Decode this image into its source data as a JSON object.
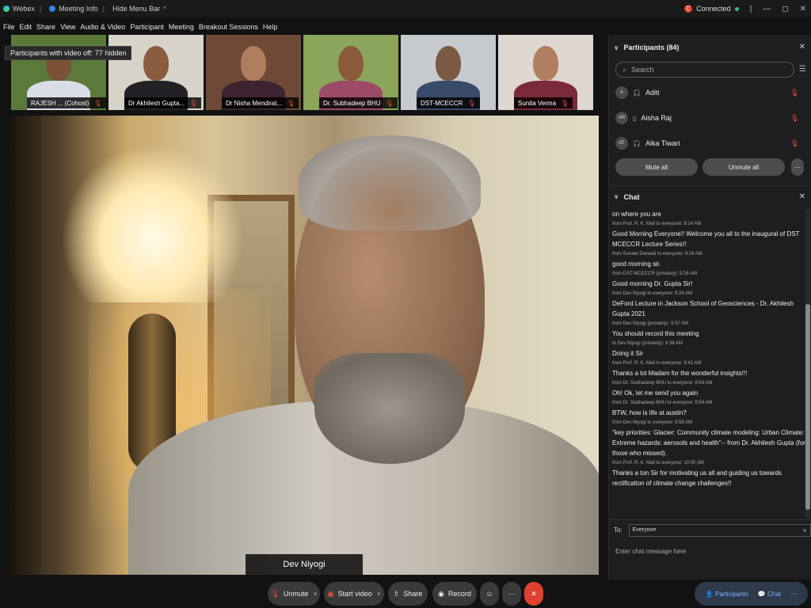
{
  "titlebar": {
    "app_name": "Webex",
    "meeting_info": "Meeting Info",
    "hide_menu": "Hide Menu Bar",
    "hide_menu_caret": "^",
    "status": "Connected",
    "rec_letter": "C",
    "min": "—",
    "max": "◻",
    "close": "✕"
  },
  "menu": [
    "File",
    "Edit",
    "Share",
    "View",
    "Audio & Video",
    "Participant",
    "Meeting",
    "Breakout Sessions",
    "Help"
  ],
  "tooltip": "Participants with video off: 77 hidden",
  "thumbnails": [
    {
      "name": "RAJESH ... (Cohost)",
      "bg": "#5b7a3a",
      "skin": "#7a5238",
      "shirt": "#d9dde6"
    },
    {
      "name": "Dr Akhilesh Gupta...",
      "bg": "#d7d3c8",
      "skin": "#8a5c3e",
      "shirt": "#222226"
    },
    {
      "name": "Dr Nisha Mendirat...",
      "bg": "#6e4a36",
      "skin": "#b07d5e",
      "shirt": "#3d2230"
    },
    {
      "name": "Dr. Subhadeep BHU",
      "bg": "#8ba65b",
      "skin": "#8b5a3d",
      "shirt": "#9d4a68"
    },
    {
      "name": "DST-MCECCR",
      "bg": "#c6c9ce",
      "skin": "#7a5a44",
      "shirt": "#3a4a6a"
    },
    {
      "name": "Sunita Verma",
      "bg": "#ddd7cf",
      "skin": "#b27e62",
      "shirt": "#7a2a3a"
    }
  ],
  "main_video": {
    "speaker": "Dev Niyogi"
  },
  "participants": {
    "title": "Participants (84)",
    "search_placeholder": "Search",
    "list": [
      {
        "initials": "A",
        "name": "Aditi",
        "device": "🎧"
      },
      {
        "initials": "AR",
        "name": "Aisha Raj",
        "device": "▯"
      },
      {
        "initials": "AT",
        "name": "Alka Tiwari",
        "device": "🎧"
      }
    ],
    "mute_all": "Mute all",
    "unmute_all": "Unmute all",
    "more": "···"
  },
  "chat": {
    "title": "Chat",
    "messages": [
      {
        "meta": "",
        "text": "on where you are"
      },
      {
        "meta": "from Prof. R. K. Mall to everyone:    9:24 AM",
        "text": "Good Morning Everyone!! Welcome you all to the inaugural of DST MCECCR Lecture Series!!"
      },
      {
        "meta": "from Suneet Dwivedi to everyone:    9:24 AM",
        "text": "good morning sir."
      },
      {
        "meta": "from DST-MCECCR (privately):    9:26 AM",
        "text": "Good morning Dr. Gupta Sir!"
      },
      {
        "meta": "from Dev Niyogi to everyone:    9:28 AM",
        "text": "DeFord Lecture in Jackson School of Geosciences - Dr. Akhilesh Gupta 2021"
      },
      {
        "meta": "from Dev Niyogi (privately):    9:37 AM",
        "text": "You should record this meeting"
      },
      {
        "meta": "to Dev Niyogi (privately):    9:38 AM",
        "text": "Doing it Sir"
      },
      {
        "meta": "from Prof. R. K. Mall to everyone:    9:41 AM",
        "text": "Thanks a lot Madam for the wonderful insights!!!"
      },
      {
        "meta": "from Dr. Subhadeep BHU to everyone:    9:54 AM",
        "text": "Oh! Ok, let me send you again"
      },
      {
        "meta": "from Dr. Subhadeep BHU to everyone:    9:54 AM",
        "text": "BTW, how is life at austin?"
      },
      {
        "meta": "from Dev Niyogi to everyone:    9:58 AM",
        "text": "\"key priorities: Glacier: Community climate modeling: Urban Climate: Extreme hazards: aerosols and health\"-- from Dr. Akhilesh Gupta (for those who missed)."
      },
      {
        "meta": "from Prof. R. K. Mall to everyone:    10:00 AM",
        "text": "Thanks a ton Sir for motivating us all and guiding us towards rectification of climate change challenges!!"
      }
    ],
    "to_label": "To:",
    "to_value": "Everyone",
    "input_placeholder": "Enter chat message here"
  },
  "controls": {
    "unmute": "Unmute",
    "start_video": "Start video",
    "share": "Share",
    "record": "Record",
    "more": "···",
    "leave": "✕",
    "participants": "Participants",
    "chat": "Chat"
  },
  "colors": {
    "accent": "#7fb3ff",
    "muted_red": "#e24b3b",
    "leave_red": "#e0412f",
    "status_green": "#2ecc71"
  }
}
